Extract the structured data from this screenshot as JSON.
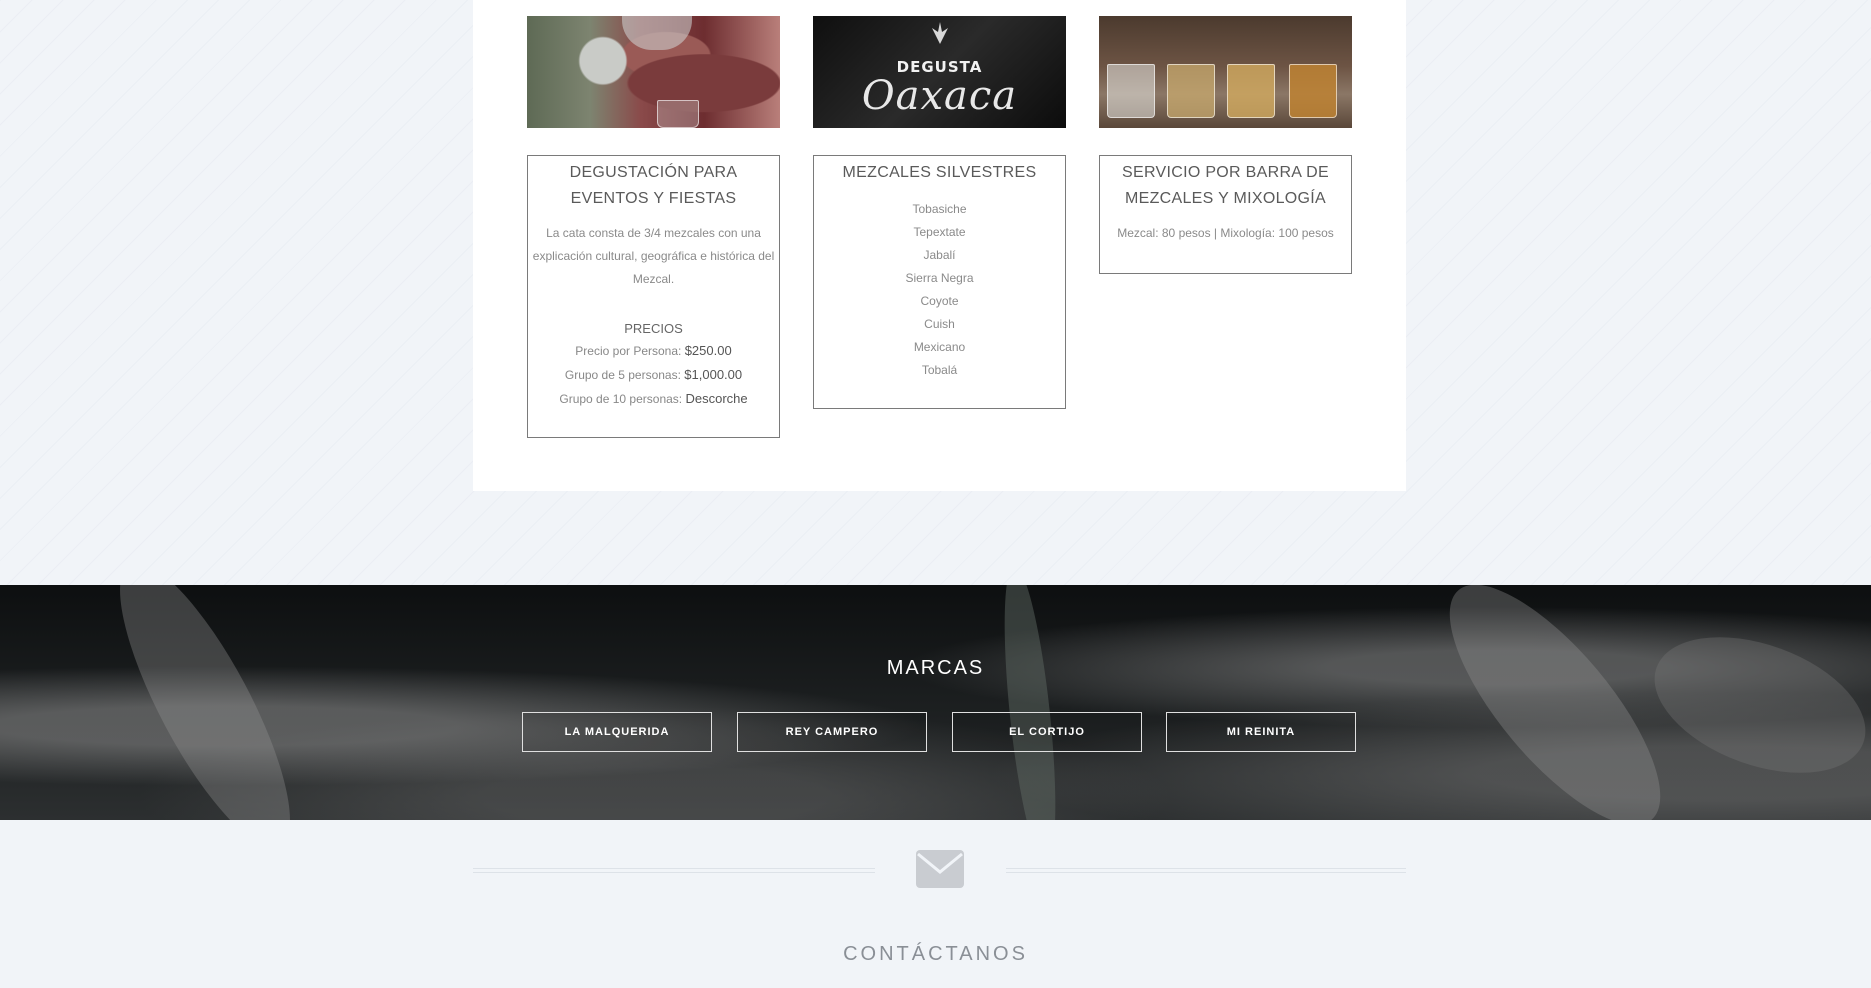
{
  "services": [
    {
      "image_caption": "",
      "title": "DEGUSTACIÓN PARA EVENTOS Y FIESTAS",
      "description": "La cata consta de 3/4 mezcales con una explicación cultural, geográfica e histórica del Mezcal.",
      "prices_heading": "PRECIOS",
      "prices": [
        {
          "label": "Precio por Persona:",
          "value": "$250.00"
        },
        {
          "label": "Grupo de 5 personas:",
          "value": "$1,000.00"
        },
        {
          "label": "Grupo de 10 personas:",
          "value": "Descorche"
        }
      ]
    },
    {
      "logo_top": "DEGUSTA",
      "logo_script": "Oaxaca",
      "title": "MEZCALES SILVESTRES",
      "items": [
        "Tobasiche",
        "Tepextate",
        "Jabalí",
        "Sierra Negra",
        "Coyote",
        "Cuish",
        "Mexicano",
        "Tobalá"
      ]
    },
    {
      "title": "SERVICIO POR BARRA DE MEZCALES Y MIXOLOGÍA",
      "description": "Mezcal: 80 pesos | Mixología: 100 pesos"
    }
  ],
  "brands": {
    "title": "MARCAS",
    "buttons": [
      "LA MALQUERIDA",
      "REY CAMPERO",
      "EL CORTIJO",
      "MI REINITA"
    ]
  },
  "contact": {
    "icon": "envelope-icon",
    "title": "CONTÁCTANOS"
  },
  "colors": {
    "page_background": "#f1f4f8",
    "panel": "#ffffff",
    "card_border": "#7a7a7a",
    "brand_section": "#1d2021"
  }
}
